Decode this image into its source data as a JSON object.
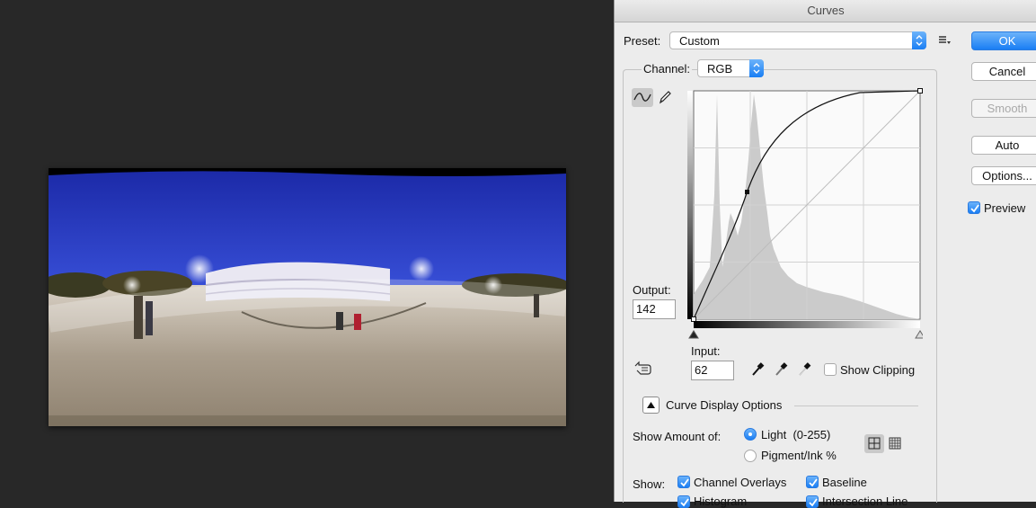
{
  "dialog": {
    "title": "Curves",
    "preset_label": "Preset:",
    "preset_value": "Custom",
    "channel_label": "Channel:",
    "channel_value": "RGB",
    "output_label": "Output:",
    "output_value": "142",
    "input_label": "Input:",
    "input_value": "62",
    "show_clipping": "Show Clipping",
    "curve_display_options": "Curve Display Options",
    "show_amount_of": "Show Amount of:",
    "light_option": "Light",
    "light_range": "(0-255)",
    "pigment_option": "Pigment/Ink %",
    "show_label": "Show:",
    "channel_overlays": "Channel Overlays",
    "baseline": "Baseline",
    "histogram": "Histogram",
    "intersection_line": "Intersection Line"
  },
  "buttons": {
    "ok": "OK",
    "cancel": "Cancel",
    "smooth": "Smooth",
    "auto": "Auto",
    "options": "Options...",
    "preview": "Preview"
  },
  "colors": {
    "accent": "#1a7ef4",
    "dialog_bg": "#ececec",
    "canvas_bg": "#282828"
  },
  "icons": {
    "preset_menu": "preset-options-icon",
    "curve_tool": "curve-point-tool-icon",
    "pencil_tool": "pencil-tool-icon",
    "target_adjust": "target-adjustment-hand-icon",
    "black_eyedropper": "black-point-eyedropper-icon",
    "gray_eyedropper": "gray-point-eyedropper-icon",
    "white_eyedropper": "white-point-eyedropper-icon",
    "simple_grid": "simple-grid-icon",
    "detailed_grid": "detailed-grid-icon"
  }
}
